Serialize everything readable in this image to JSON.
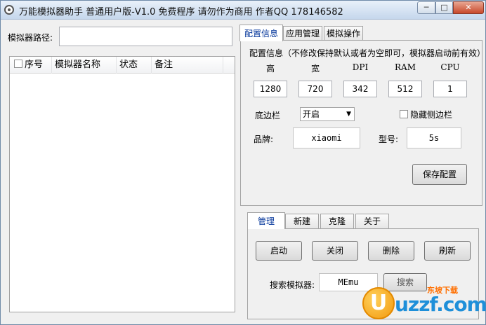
{
  "titlebar": {
    "title": "万能模拟器助手 普通用户版-V1.0  免费程序  请勿作为商用  作者QQ 178146582",
    "min_glyph": "─",
    "max_glyph": "□",
    "close_glyph": "✕"
  },
  "left": {
    "path_label": "模拟器路径:",
    "path_value": "",
    "columns": [
      "序号",
      "模拟器名称",
      "状态",
      "备注"
    ]
  },
  "top_tabs": [
    "配置信息",
    "应用管理",
    "模拟操作"
  ],
  "config": {
    "heading": "配置信息（不修改保持默认或者为空即可，模拟器启动前有效）",
    "headers": [
      "高",
      "宽",
      "DPI",
      "RAM",
      "CPU"
    ],
    "values": [
      "1280",
      "720",
      "342",
      "512",
      "1"
    ],
    "bottom_bar_label": "底边栏",
    "bottom_bar_value": "开启",
    "hide_sidebar_label": "隐藏侧边栏",
    "brand_label": "品牌:",
    "brand_value": "xiaomi",
    "model_label": "型号:",
    "model_value": "5s",
    "save_button": "保存配置"
  },
  "bottom_tabs": [
    "管理",
    "新建",
    "克隆",
    "关于"
  ],
  "manage": {
    "start": "启动",
    "close": "关闭",
    "delete": "删除",
    "refresh": "刷新",
    "search_label": "搜索模拟器:",
    "search_value": "MEmu",
    "search_button": "搜索"
  },
  "watermark": {
    "mark": "U",
    "site": "uzzf.com",
    "tagline": "东坡下载"
  }
}
